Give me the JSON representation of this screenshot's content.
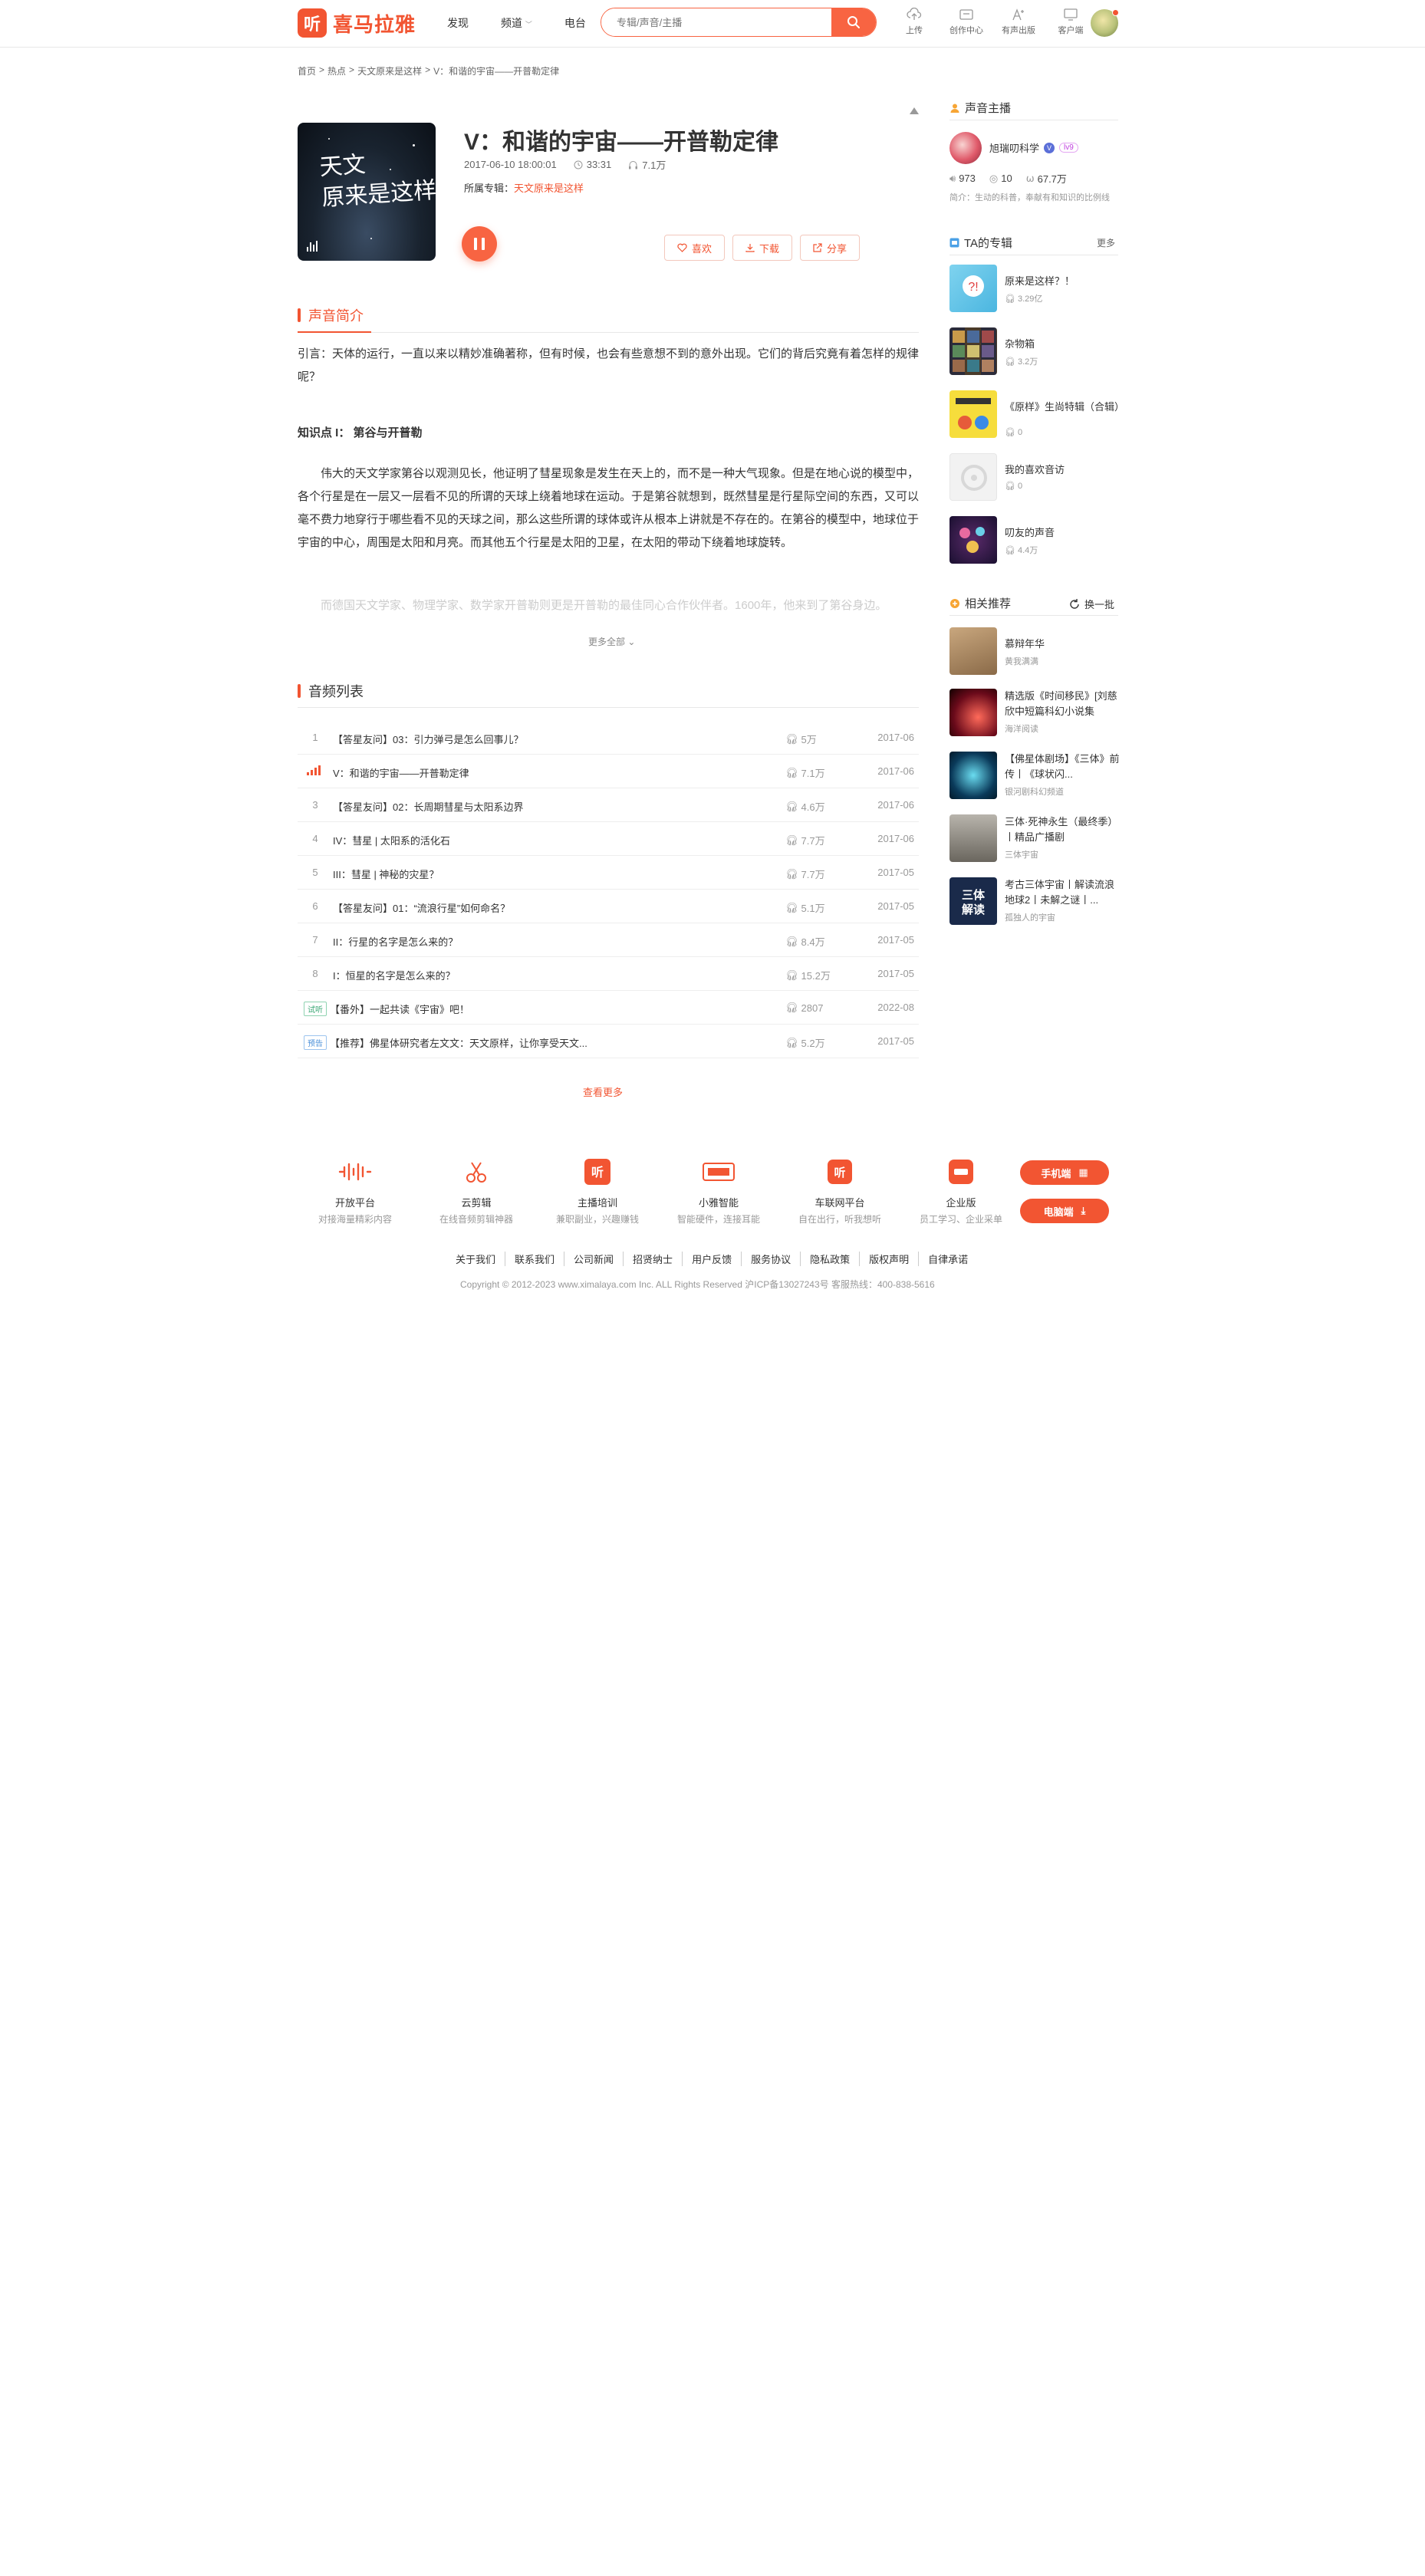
{
  "header": {
    "logo_mark": "听",
    "logo_text": "喜马拉雅",
    "nav": [
      "发现",
      "频道",
      "电台"
    ],
    "search_placeholder": "专辑/声音/主播",
    "tools": [
      "上传",
      "创作中心",
      "有声出版",
      "客户端"
    ]
  },
  "breadcrumb": [
    "首页",
    ">",
    "热点",
    ">",
    "天文原来是这样",
    ">",
    "V：和谐的宇宙——开普勒定律"
  ],
  "track": {
    "cover_title_line1": "天文",
    "cover_title_line2": "原来是这样",
    "title": "V：和谐的宇宙——开普勒定律",
    "datetime": "2017-06-10 18:00:01",
    "duration": "33:31",
    "plays": "7.1万",
    "album_label": "所属专辑：",
    "album_name": "天文原来是这样",
    "actions": [
      "喜欢",
      "下载",
      "分享"
    ]
  },
  "intro": {
    "heading": "声音简介",
    "lead": "引言：天体的运行，一直以来以精妙准确著称，但有时候，也会有些意想不到的意外出现。它们的背后究竟有着怎样的规律呢？",
    "subheading": "知识点 I： 第谷与开普勒",
    "body": "伟大的天文学家第谷以观测见长，他证明了彗星现象是发生在天上的，而不是一种大气现象。但是在地心说的模型中，各个行星是在一层又一层看不见的所谓的天球上绕着地球在运动。于是第谷就想到，既然彗星是行星际空间的东西，又可以毫不费力地穿行于哪些看不见的天球之间，那么这些所谓的球体或许从根本上讲就是不存在的。在第谷的模型中，地球位于宇宙的中心，周围是太阳和月亮。而其他五个行星是太阳的卫星，在太阳的带动下绕着地球旋转。",
    "faded": "而德国天文学家、物理学家、数学家开普勒则更是开普勒的最佳同心合作伙伴者。1600年，他来到了第谷身边。",
    "more": "更多全部"
  },
  "tracklist": {
    "heading": "音频列表",
    "items": [
      {
        "num": "1",
        "tag": "",
        "name": "【答星友问】03：引力弹弓是怎么回事儿？",
        "plays": "5万",
        "date": "2017-06"
      },
      {
        "num": "",
        "tag": "",
        "name": "V：和谐的宇宙——开普勒定律",
        "plays": "7.1万",
        "date": "2017-06"
      },
      {
        "num": "3",
        "tag": "",
        "name": "【答星友问】02：长周期彗星与太阳系边界",
        "plays": "4.6万",
        "date": "2017-06"
      },
      {
        "num": "4",
        "tag": "",
        "name": "IV：彗星 | 太阳系的活化石",
        "plays": "7.7万",
        "date": "2017-06"
      },
      {
        "num": "5",
        "tag": "",
        "name": "III：彗星 | 神秘的灾星？",
        "plays": "7.7万",
        "date": "2017-05"
      },
      {
        "num": "6",
        "tag": "",
        "name": "【答星友问】01：“流浪行星”如何命名？",
        "plays": "5.1万",
        "date": "2017-05"
      },
      {
        "num": "7",
        "tag": "",
        "name": "II：行星的名字是怎么来的？",
        "plays": "8.4万",
        "date": "2017-05"
      },
      {
        "num": "8",
        "tag": "",
        "name": "I：恒星的名字是怎么来的？",
        "plays": "15.2万",
        "date": "2017-05"
      },
      {
        "num": "",
        "tag": "试听",
        "name": "【番外】一起共读《宇宙》吧！",
        "plays": "2807",
        "date": "2022-08"
      },
      {
        "num": "",
        "tag": "预告",
        "name": "【推荐】佛星体研究者左文文：天文原样，让你享受天文...",
        "plays": "5.2万",
        "date": "2017-05"
      }
    ],
    "see_more": "查看更多"
  },
  "sidebar": {
    "anchor_heading": "声音主播",
    "anchor_name": "旭瑞叨科学",
    "anchor_level": "lv9",
    "anchor_v": "V",
    "stats": [
      "973",
      "10",
      "67.7万"
    ],
    "anchor_desc": "简介：生动的科普，奉献有和知识的比例线",
    "albums_heading": "TA的专辑",
    "more": "更多",
    "albums": [
      {
        "title": "原来是这样？！",
        "count": "3.29亿"
      },
      {
        "title": "杂物箱",
        "count": "3.2万"
      },
      {
        "title": "《原样》生尚特辑（合辑）",
        "count": "0"
      },
      {
        "title": "我的喜欢音访",
        "count": "0"
      },
      {
        "title": "叨友的声音",
        "count": "4.4万"
      }
    ],
    "rec_heading": "相关推荐",
    "change": "换一批",
    "recommend": [
      {
        "title": "慕辩年华",
        "sub": "黄我满满"
      },
      {
        "title": "精选版《时间移民》[刘慈欣中短篇科幻小说集",
        "sub": "海洋阅读"
      },
      {
        "title": "【佛星体剧场】《三体》前传丨《球状闪...",
        "sub": "银河剧科幻频道"
      },
      {
        "title": "三体·死神永生（最终季）丨精品广播剧",
        "sub": "三体宇宙"
      },
      {
        "title": "考古三体宇宙丨解读流浪地球2丨未解之谜丨...",
        "sub": "孤独人的宇宙"
      }
    ]
  },
  "footer": {
    "items": [
      {
        "name": "开放平台",
        "desc": "对接海量精彩内容"
      },
      {
        "name": "云剪辑",
        "desc": "在线音频剪辑神器"
      },
      {
        "name": "主播培训",
        "desc": "兼职副业，兴趣赚钱"
      },
      {
        "name": "小雅智能",
        "desc": "智能硬件，连接耳能"
      },
      {
        "name": "车联网平台",
        "desc": "自在出行，听我想听"
      },
      {
        "name": "企业版",
        "desc": "员工学习、企业采单"
      }
    ],
    "phone_btn": "手机端",
    "pc_btn": "电脑端",
    "links": [
      "关于我们",
      "联系我们",
      "公司新闻",
      "招贤纳士",
      "用户反馈",
      "服务协议",
      "隐私政策",
      "版权声明",
      "自律承诺"
    ],
    "copyright": "Copyright © 2012-2023 www.ximalaya.com Inc. ALL Rights Reserved 沪ICP备13027243号 客服热线：400-838-5616"
  },
  "colors": {
    "accent": "#f25532",
    "accent_light": "#f86442"
  }
}
